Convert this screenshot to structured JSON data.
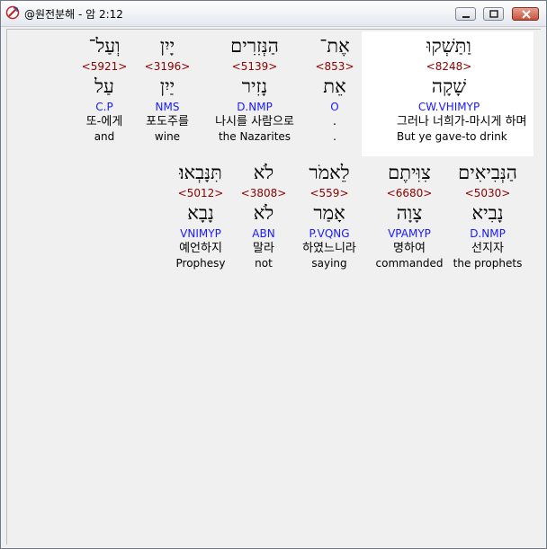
{
  "window": {
    "title": "@원전분해 - 암 2:12"
  },
  "row1": [
    {
      "hebrew": "וַתַּשְׁקוּ",
      "strong": "<8248>",
      "lemma": "שָׁקָה",
      "parse": "CW.VHIMYP",
      "korean": "그러나 너희가-마시게 하며",
      "english": "But ye gave-to drink"
    },
    {
      "hebrew": "אֶת־",
      "strong": "<853>",
      "lemma": "אֵת",
      "parse": "O",
      "korean": ".",
      "english": "."
    },
    {
      "hebrew": "הַנְּזִרִים",
      "strong": "<5139>",
      "lemma": "נָזִיר",
      "parse": "D.NMP",
      "korean": "나시를 사람으로",
      "english": "the Nazarites"
    },
    {
      "hebrew": "יָיִן",
      "strong": "<3196>",
      "lemma": "יַיִן",
      "parse": "NMS",
      "korean": "포도주를",
      "english": "wine"
    },
    {
      "hebrew": "וְעַל־",
      "strong": "<5921>",
      "lemma": "עַל",
      "parse": "C.P",
      "korean": "또-에게",
      "english": "and"
    }
  ],
  "row2": [
    {
      "hebrew": "הַנְּבִיאִים",
      "strong": "<5030>",
      "lemma": "נָבִיא",
      "parse": "D.NMP",
      "korean": "선지자",
      "english": "the prophets"
    },
    {
      "hebrew": "צִוִּיתֶם",
      "strong": "<6680>",
      "lemma": "צָוָה",
      "parse": "VPAMYP",
      "korean": "명하여",
      "english": "commanded"
    },
    {
      "hebrew": "לֵאמֹר",
      "strong": "<559>",
      "lemma": "אָמַר",
      "parse": "P.VQNG",
      "korean": "하였느니라",
      "english": "saying"
    },
    {
      "hebrew": "לֹא",
      "strong": "<3808>",
      "lemma": "לֹא",
      "parse": "ABN",
      "korean": "말라",
      "english": "not"
    },
    {
      "hebrew": "תִּנָּבְאוּ׃",
      "strong": "<5012>",
      "lemma": "נָבָא",
      "parse": "VNIMYP",
      "korean": "예언하지",
      "english": "Prophesy"
    }
  ]
}
